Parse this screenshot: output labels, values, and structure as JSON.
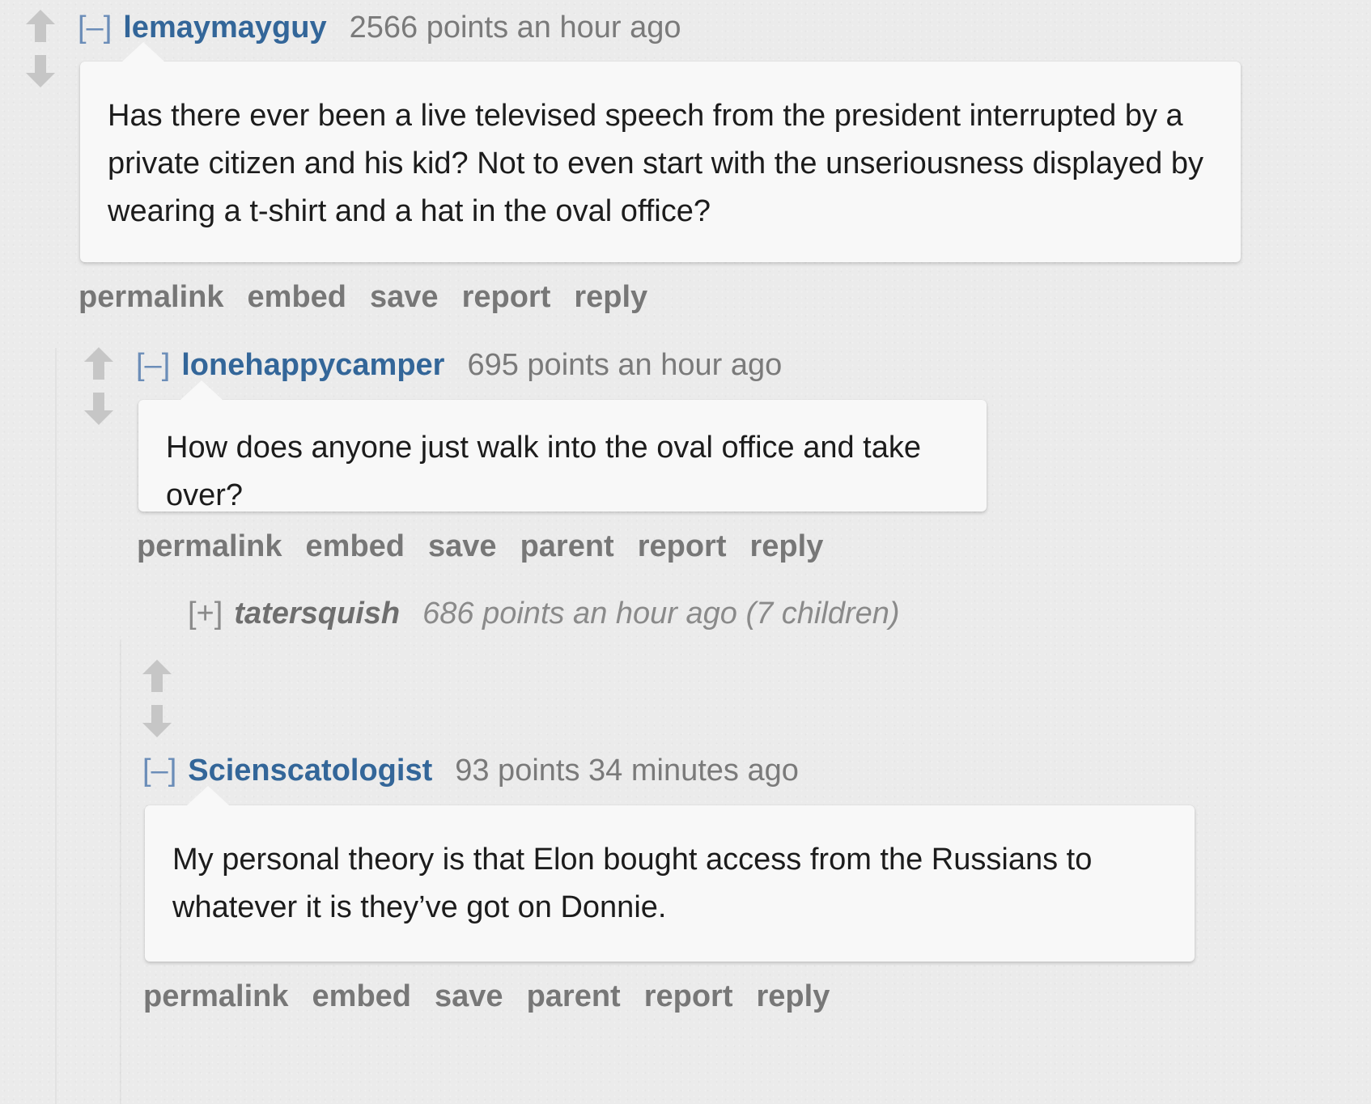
{
  "comments": [
    {
      "expand": "[–]",
      "author": "lemaymayguy",
      "meta": "2566 points an hour ago",
      "body": "Has there ever been a live televised speech from the president interrupted by a private citizen and his kid? Not to even start with the unseriousness displayed by wearing a t-shirt and a hat in the oval office?",
      "buttons": [
        "permalink",
        "embed",
        "save",
        "report",
        "reply"
      ]
    },
    {
      "expand": "[–]",
      "author": "lonehappycamper",
      "meta": "695 points an hour ago",
      "body": "How does anyone just walk into the oval office and take over?",
      "buttons": [
        "permalink",
        "embed",
        "save",
        "parent",
        "report",
        "reply"
      ]
    },
    {
      "expand": "[+]",
      "author": "tatersquish",
      "meta": "686 points an hour ago (7 children)",
      "collapsed": true
    },
    {
      "expand": "[–]",
      "author": "Scienscatologist",
      "meta": "93 points 34 minutes ago",
      "body": "My personal theory is that Elon bought access from the Russians to whatever it is they’ve got on Donnie.",
      "buttons": [
        "permalink",
        "embed",
        "save",
        "parent",
        "report",
        "reply"
      ]
    }
  ],
  "icons": {
    "upvote": "upvote-arrow-icon",
    "downvote": "downvote-arrow-icon"
  },
  "colors": {
    "author": "#336699",
    "meta": "#7a7a7a",
    "buttons": "#777777",
    "arrow": "#c6c6c6"
  }
}
